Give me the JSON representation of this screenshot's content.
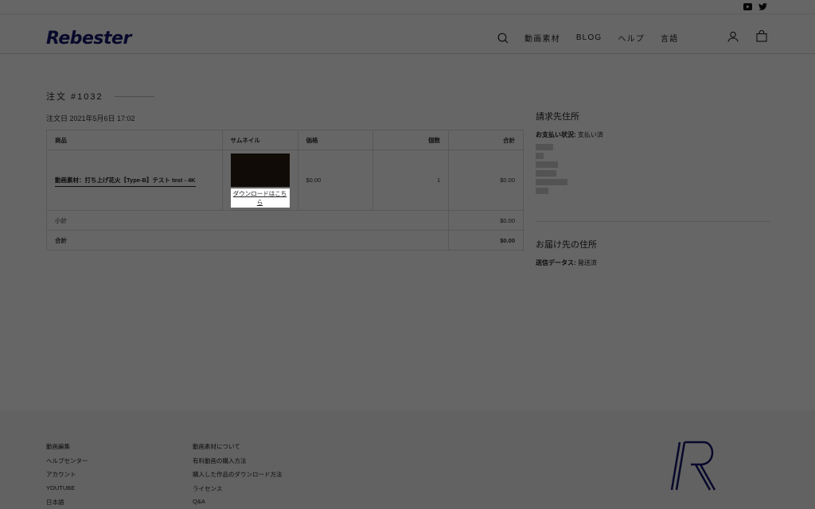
{
  "topbar": {
    "youtube_icon": "youtube-icon",
    "twitter_icon": "twitter-icon"
  },
  "header": {
    "logo_text": "Rebester",
    "nav": [
      "動画素材",
      "BLOG",
      "ヘルプ",
      "言語"
    ]
  },
  "order": {
    "title": "注文 #1032",
    "date": "注文日 2021年5月6日 17:02",
    "columns": {
      "product": "商品",
      "thumbnail": "サムネイル",
      "price": "価格",
      "qty": "個数",
      "total": "合計"
    },
    "item": {
      "name": "動画素材：打ち上げ花火【Type-B】テスト test - 4K",
      "download_label": "ダウンロードはこちら",
      "price": "$0.00",
      "qty": "1",
      "total": "$0.00"
    },
    "subtotal_label": "小計",
    "subtotal_value": "$0.00",
    "grand_label": "合計",
    "grand_value": "$0.00"
  },
  "billing": {
    "heading": "請求先住所",
    "status_label": "お支払い状況:",
    "status_value": "支払い済"
  },
  "shipping": {
    "heading": "お届け先の住所",
    "status_label": "送信データス:",
    "status_value": "発送済"
  },
  "footer": {
    "col1": [
      "動画編集",
      "ヘルプセンター",
      "アカウント",
      "YOUTUBE",
      "日本語"
    ],
    "col2": [
      "動画素材について",
      "有料動画の購入方法",
      "購入した作品のダウンロード方法",
      "ライセンス",
      "Q&A"
    ]
  },
  "colors": {
    "brand": "#14156e",
    "overlay": "rgba(0,0,0,0.6)"
  }
}
